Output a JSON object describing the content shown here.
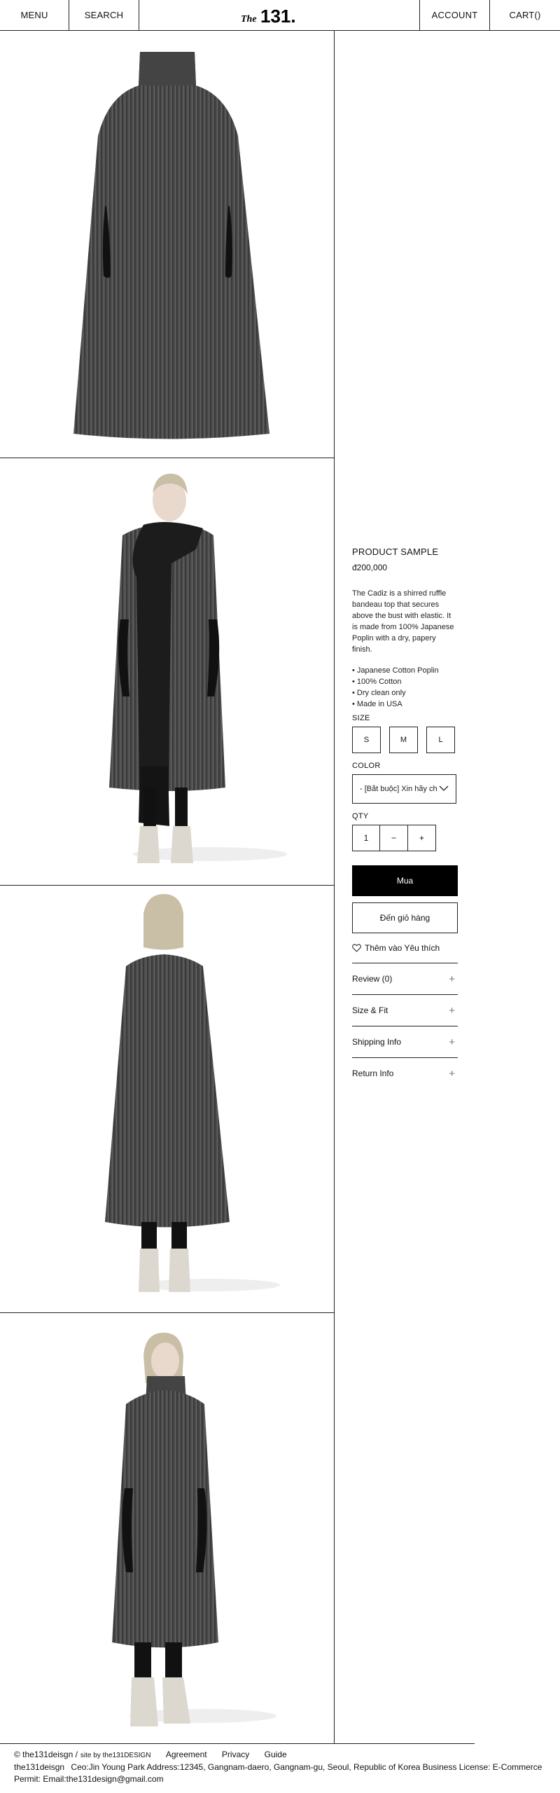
{
  "header": {
    "menu": "MENU",
    "search": "SEARCH",
    "logo_text": "131.",
    "logo_prefix": "The",
    "account": "ACCOUNT",
    "cart": "CART()"
  },
  "product": {
    "name": "PRODUCT SAMPLE",
    "price": "đ200,000",
    "description": "The Cadiz is a shirred ruffle bandeau top that secures above the bust with elastic. It is made from 100% Japanese Poplin with a dry, papery finish.",
    "bullets": [
      "• Japanese Cotton Poplin",
      "• 100% Cotton",
      "• Dry clean only",
      "• Made in USA"
    ],
    "size_label": "SIZE",
    "sizes": [
      "S",
      "M",
      "L"
    ],
    "color_label": "COLOR",
    "color_value": "- [Bắt buộc] Xin hãy chọn một tùy chọn -",
    "qty_label": "QTY",
    "qty_value": "1",
    "qty_minus": "−",
    "qty_plus": "+",
    "buy_label": "Mua",
    "cart_label": "Đến giỏ hàng",
    "wishlist_label": "Thêm vào Yêu thích",
    "accordion": [
      "Review (0)",
      "Size & Fit",
      "Shipping Info",
      "Return Info"
    ]
  },
  "footer": {
    "copyright": "© the131deisgn /",
    "site_by": "site by the131DESIGN",
    "links": [
      "Agreement",
      "Privacy",
      "Guide"
    ],
    "company": "the131deisgn",
    "address": "Ceo:Jin Young Park Address:12345, Gangnam-daero, Gangnam-gu, Seoul, Republic of Korea Business License: E-Commerce",
    "permit": "Permit: Email:the131design@gmail.com"
  },
  "colors": {
    "knit": "#4a4a4a",
    "scarf": "#1c1c1c",
    "boots": "#dcd8cf",
    "hair": "#c9bfa6",
    "skin": "#e9d8cc",
    "line": "#222222"
  }
}
